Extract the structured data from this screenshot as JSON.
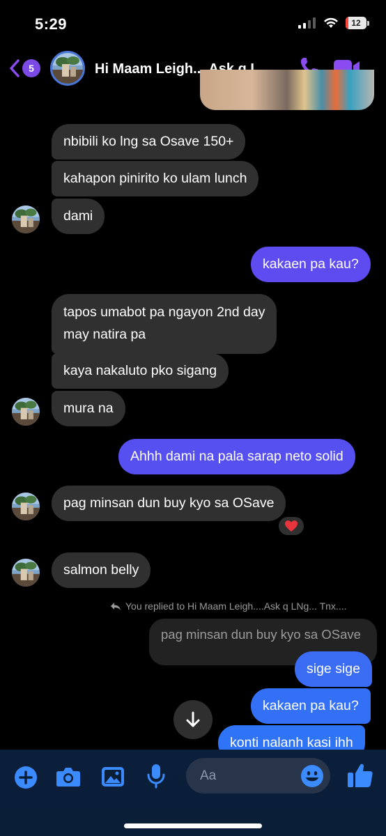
{
  "status_bar": {
    "time": "5:29",
    "battery": "12",
    "battery_level": 0.12,
    "cellular_bars": 2
  },
  "header": {
    "back_badge": "5",
    "title": "Hi Maam Leigh....Ask q L...",
    "accent_color": "#8a4cf0"
  },
  "messages": [
    {
      "text": "nbibili ko lng sa Osave 150+",
      "from": "them"
    },
    {
      "text": "kahapon pinirito ko ulam lunch",
      "from": "them"
    },
    {
      "text": "dami",
      "from": "them"
    },
    {
      "text": "kakaen pa kau?",
      "from": "me"
    },
    {
      "text": "tapos umabot pa ngayon 2nd day",
      "from": "them"
    },
    {
      "text": "may natira pa",
      "from": "them"
    },
    {
      "text": "kaya nakaluto pko sigang",
      "from": "them"
    },
    {
      "text": "mura na",
      "from": "them"
    },
    {
      "text": "Ahhh dami na pala sarap neto solid",
      "from": "me"
    },
    {
      "text": "pag minsan dun buy kyo sa OSave",
      "from": "them",
      "reaction": "heart"
    },
    {
      "text": "salmon belly",
      "from": "them"
    },
    {
      "text": "sige sige",
      "from": "me"
    },
    {
      "text": "kakaen pa kau?",
      "from": "me"
    },
    {
      "text": "konti nalanh kasi ihh",
      "from": "me"
    }
  ],
  "reply_context": {
    "note": "You replied to Hi Maam Leigh....Ask q LNg... Tnx....",
    "quoted_text": "pag minsan dun buy kyo sa OSave"
  },
  "composer": {
    "placeholder": "Aa"
  },
  "colors": {
    "sent_top": "#6a4cf0",
    "sent_bottom": "#2d7cf6",
    "received": "#303030",
    "icon_blue": "#3b8bff"
  },
  "icons": [
    "back-chevron-icon",
    "phone-icon",
    "video-camera-icon",
    "plus-icon",
    "camera-icon",
    "gallery-icon",
    "microphone-icon",
    "emoji-icon",
    "thumbs-up-icon",
    "arrow-down-icon",
    "reply-arrow-icon",
    "heart-icon"
  ]
}
